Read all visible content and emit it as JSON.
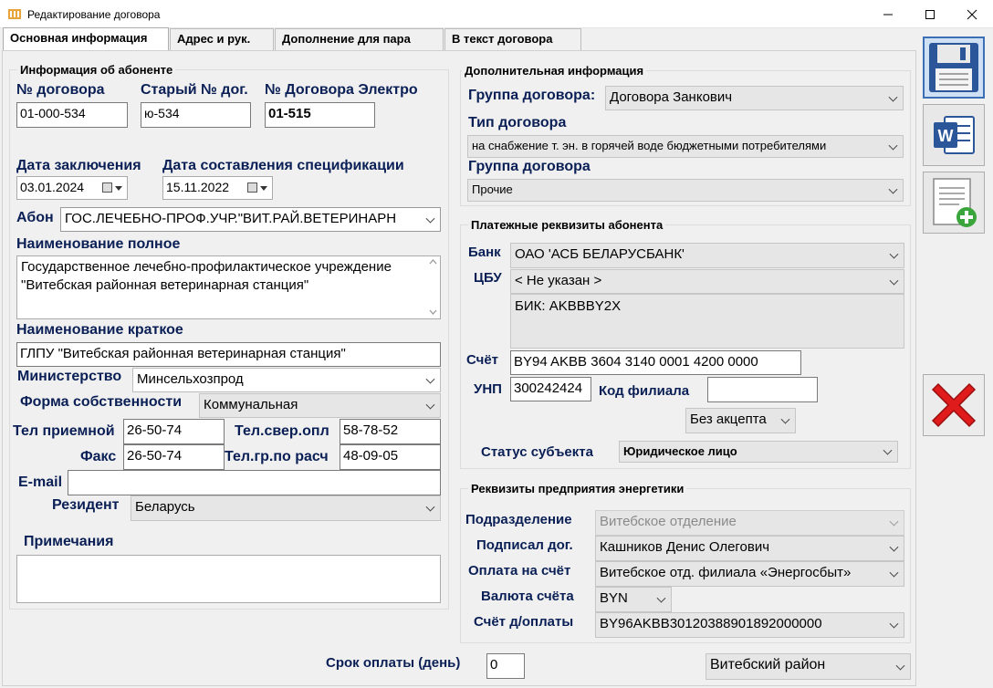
{
  "window": {
    "title": "Редактирование договора"
  },
  "tabs": [
    "Основная информация",
    "Адрес и рук.",
    "Дополнение для пара",
    "В текст договора"
  ],
  "subscriber": {
    "group_title": "Информация об абоненте",
    "contract_no_label": "№ договора",
    "contract_no": "01-000-534",
    "old_no_label": "Старый № дог.",
    "old_no": "ю-534",
    "electro_no_label": "№ Договора Электро",
    "electro_no": "01-515",
    "date_concluded_label": "Дата заключения",
    "date_concluded": "03.01.2024",
    "date_spec_label": "Дата составления спецификации",
    "date_spec": "15.11.2022",
    "abon_label": "Абон",
    "abon": "ГОС.ЛЕЧЕБНО-ПРОФ.УЧР.\"ВИТ.РАЙ.ВЕТЕРИНАРН",
    "full_name_label": "Наименование полное",
    "full_name": "Государственное лечебно-профилактическое учреждение \"Витебская районная ветеринарная станция\"",
    "short_name_label": "Наименование краткое",
    "short_name": "ГЛПУ \"Витебская районная ветеринарная станция\"",
    "ministry_label": "Министерство",
    "ministry": "Минсельхозпрод",
    "ownership_label": "Форма собственности",
    "ownership": "Коммунальная",
    "tel_reception_label": "Тел приемной",
    "tel_reception": "26-50-74",
    "tel_reconcile_label": "Тел.свер.опл",
    "tel_reconcile": "58-78-52",
    "fax_label": "Факс",
    "fax": "26-50-74",
    "tel_calc_label": "Тел.гр.по расч",
    "tel_calc": "48-09-05",
    "email_label": "E-mail",
    "email": "",
    "resident_label": "Резидент",
    "resident": "Беларусь",
    "notes_label": "Примечания",
    "notes": ""
  },
  "additional": {
    "group_title": "Дополнительная информация",
    "group_label": "Группа договора:",
    "group": "Договора Занкович",
    "type_label": "Тип договора",
    "type": "на снабжение т. эн. в горячей воде бюджетными потребителями",
    "group2_label": "Группа договора",
    "group2": "Прочие"
  },
  "payment": {
    "group_title": "Платежные реквизиты абонента",
    "bank_label": "Банк",
    "bank": "ОАО 'АСБ БЕЛАРУСБАНК'",
    "cbu_label": "ЦБУ",
    "cbu": "< Не указан >",
    "bik": "БИК: AKBBBY2X",
    "account_label": "Счёт",
    "account": "BY94 AKBB 3604 3140 0001 4200 0000",
    "unp_label": "УНП",
    "unp": "300242424",
    "branch_code_label": "Код филиала",
    "branch_code": "",
    "acceptance": "Без акцепта",
    "status_label": "Статус субъекта",
    "status": "Юридическое лицо"
  },
  "energy": {
    "group_title": "Реквизиты предприятия энергетики",
    "division_label": "Подразделение",
    "division": "Витебское отделение",
    "signed_label": "Подписал дог.",
    "signed": "Кашников Денис Олегович",
    "pay_account_label": "Оплата на счёт",
    "pay_account": "Витебское отд. филиала «Энергосбыт»",
    "currency_label": "Валюта счёта",
    "currency": "BYN",
    "pay_acc_no_label": "Счёт д/оплаты",
    "pay_acc_no": "BY96AKBB30120388901892000000"
  },
  "footer": {
    "term_label": "Срок оплаты (день)",
    "term": "0",
    "district": "Витебский район"
  },
  "toolbar": {
    "save_icon": "floppy-disk-icon",
    "word_icon": "word-icon",
    "new_doc_icon": "document-add-icon",
    "cancel_icon": "red-x-icon",
    "accent": "#2b579a",
    "cancel_color": "#e01b1b"
  }
}
